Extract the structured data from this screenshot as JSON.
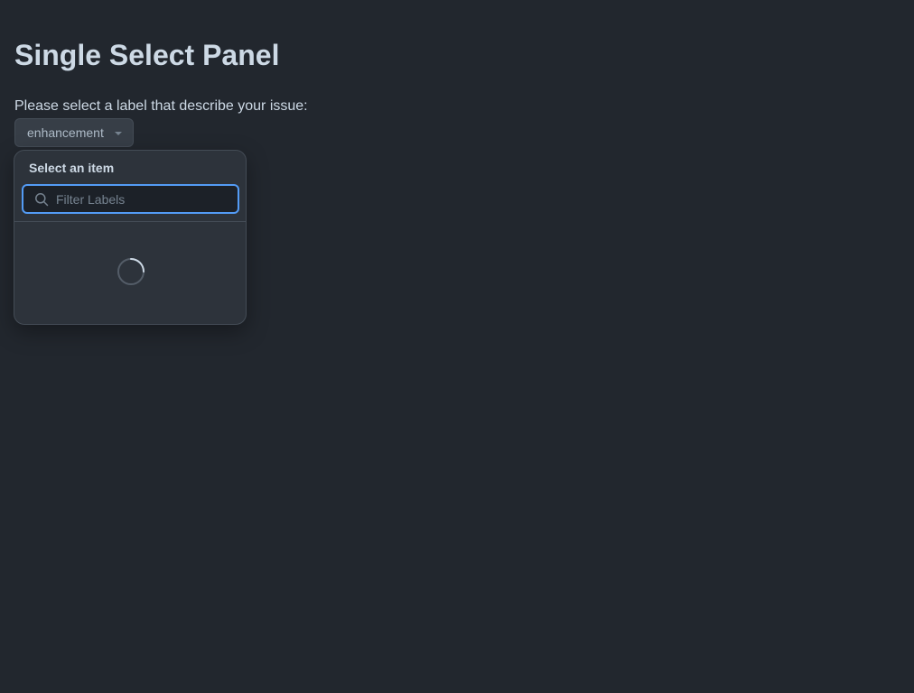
{
  "page": {
    "title": "Single Select Panel",
    "prompt": "Please select a label that describe your issue:"
  },
  "select_button": {
    "label": "enhancement",
    "icon": "triangle-down-icon"
  },
  "panel": {
    "title": "Select an item",
    "filter": {
      "value": "",
      "placeholder": "Filter Labels",
      "icon": "search-icon"
    },
    "status": "loading",
    "loading_icon": "spinner-icon"
  },
  "colors": {
    "background": "#22272e",
    "panel_background": "#2d333b",
    "focus_border": "#539bf5",
    "border": "#444c56"
  }
}
